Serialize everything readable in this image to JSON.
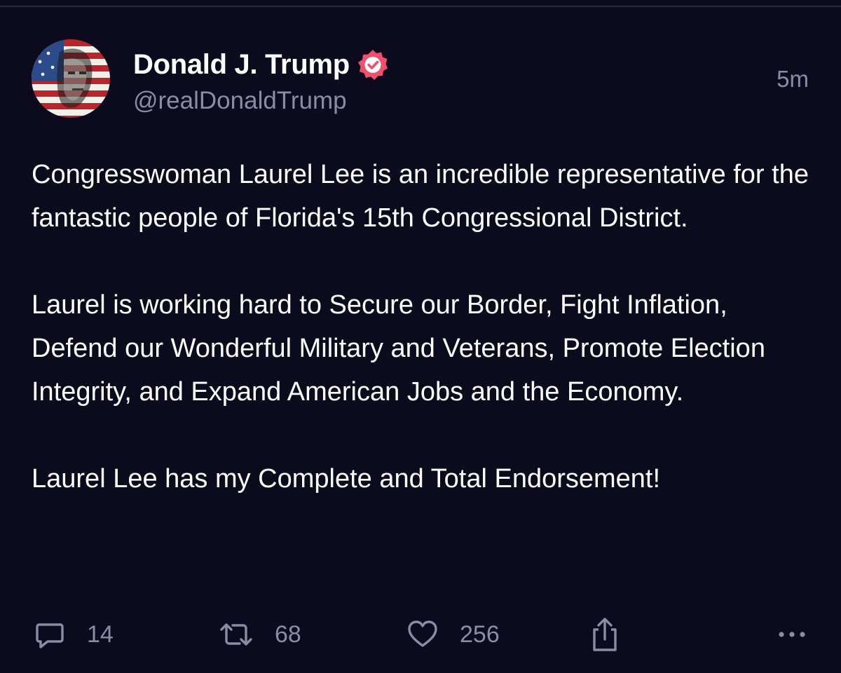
{
  "post": {
    "author": {
      "display_name": "Donald J. Trump",
      "handle": "@realDonaldTrump",
      "verified": true,
      "verified_color": "#f0506e",
      "avatar": "avatar-flag-portrait"
    },
    "timestamp": "5m",
    "paragraphs": [
      "Congresswoman Laurel Lee is an incredible representative for the fantastic people of Florida's 15th Congressional District.",
      "Laurel is working hard to Secure our Border, Fight Inflation, Defend our Wonderful Military and Veterans, Promote Election Integrity, and Expand American Jobs and the Economy.",
      "Laurel Lee has my Complete and Total Endorsement!"
    ],
    "actions": {
      "replies": {
        "icon": "reply-icon",
        "count": "14"
      },
      "reposts": {
        "icon": "repost-icon",
        "count": "68"
      },
      "likes": {
        "icon": "heart-icon",
        "count": "256"
      },
      "share": {
        "icon": "share-icon"
      },
      "more": {
        "icon": "more-icon"
      }
    }
  },
  "colors": {
    "background": "#0c0a1d",
    "text_primary": "#ffffff",
    "text_secondary": "#8e8aa6"
  }
}
